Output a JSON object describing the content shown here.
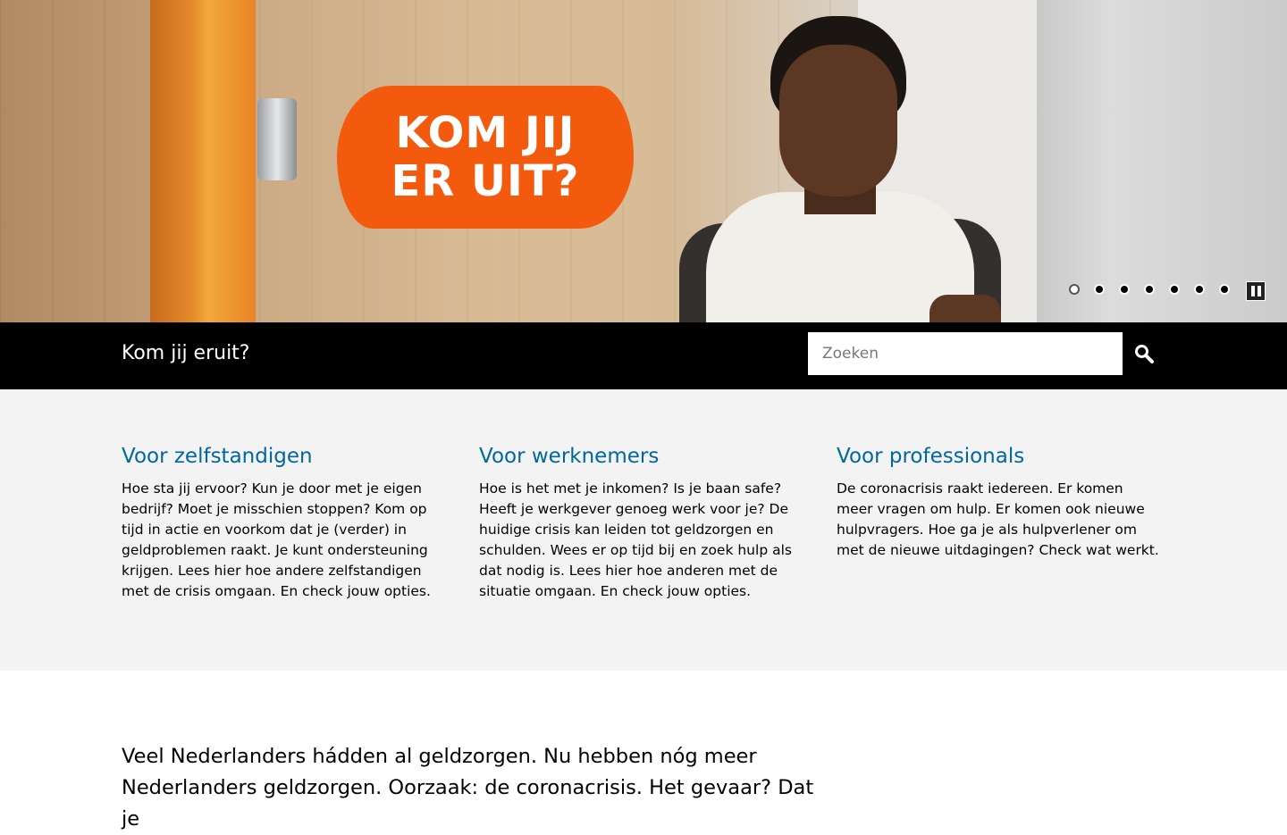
{
  "hero": {
    "badge_text": "KOM JIJ\nER UIT?",
    "slides": [
      1,
      2,
      3,
      4,
      5,
      6,
      7
    ],
    "active_slide": 1
  },
  "header": {
    "site_title": "Kom jij eruit?",
    "search_placeholder": "Zoeken"
  },
  "cards": [
    {
      "title": "Voor zelfstandigen",
      "text": "Hoe sta jij ervoor? Kun je door met je eigen bedrijf? Moet je misschien stoppen? Kom op tijd in actie en voorkom dat je (verder) in geldproblemen raakt. Je kunt ondersteuning krijgen. Lees hier hoe andere zelfstandigen met de crisis omgaan. En check jouw opties."
    },
    {
      "title": "Voor werknemers",
      "text": "Hoe is het met je inkomen? Is je baan safe? Heeft je werkgever genoeg werk voor je? De huidige crisis kan leiden tot geldzorgen en schulden. Wees er op tijd bij en zoek hulp als dat nodig is. Lees hier hoe anderen met de situatie omgaan. En check jouw opties."
    },
    {
      "title": "Voor professionals",
      "text": "De coronacrisis raakt iedereen. Er komen meer vragen om hulp. Er komen ook nieuwe hulpvragers. Hoe ga je als hulpverlener om met de nieuwe uitdagingen? Check wat werkt."
    }
  ],
  "intro": {
    "text": "Veel Nederlanders hádden al geldzorgen. Nu hebben nóg meer Nederlanders geldzorgen. Oorzaak: de coronacrisis. Het gevaar? Dat je"
  },
  "colors": {
    "link_blue": "#01689b",
    "badge_orange": "#f35a0e",
    "bar_black": "#000000",
    "cards_bg": "#f3f3f3"
  },
  "icons": {
    "search": "search-icon",
    "pause": "pause-icon"
  }
}
